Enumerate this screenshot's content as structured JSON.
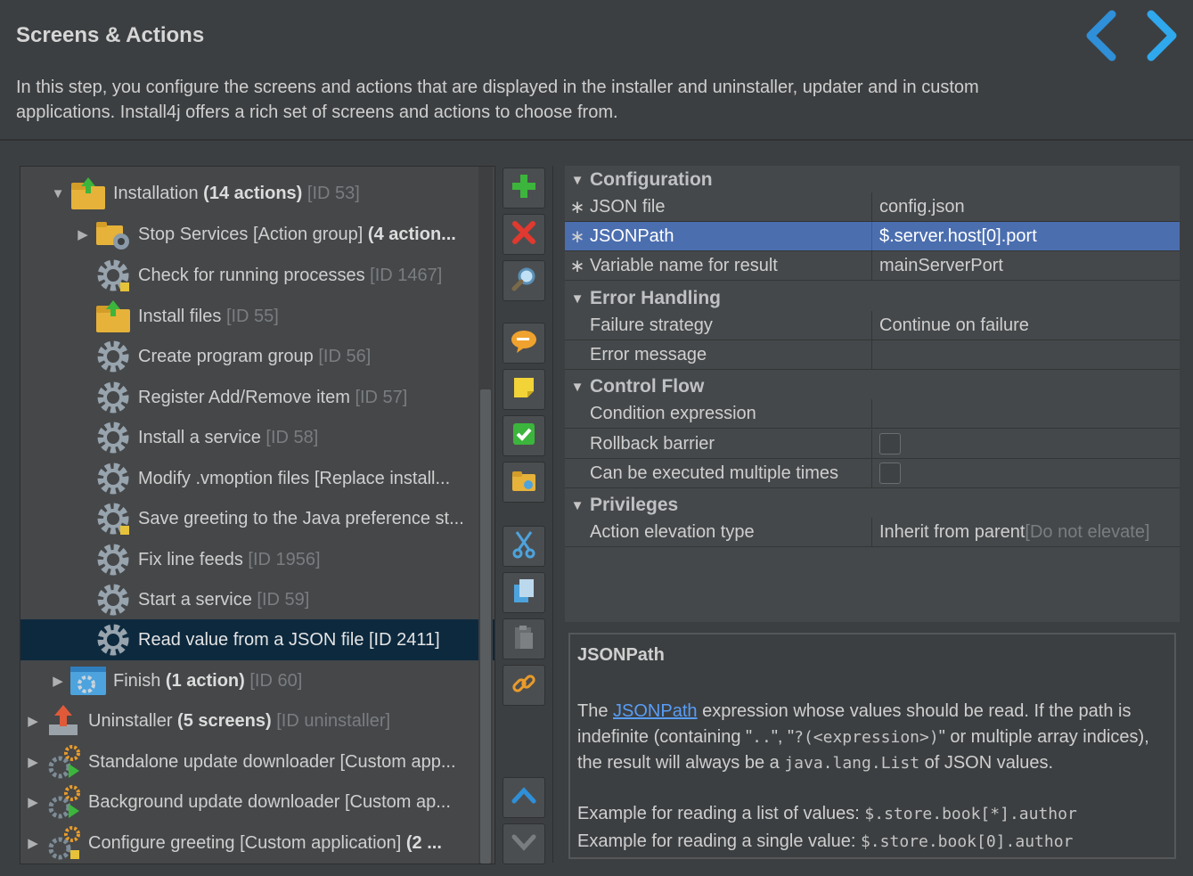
{
  "header": {
    "title": "Screens & Actions",
    "description": "In this step, you configure the screens and actions that are displayed in the installer and uninstaller, updater and in custom applications. Install4j offers a rich set of screens and actions to choose from."
  },
  "tree": {
    "items": [
      {
        "name": "Installation ",
        "bold": "(14 actions)",
        "id": " [ID 53]"
      },
      {
        "name": "Stop Services [Action group] ",
        "bold": "(4 action...",
        "id": ""
      },
      {
        "name": "Check for running processes ",
        "bold": "",
        "id": "[ID 1467]"
      },
      {
        "name": "Install files ",
        "bold": "",
        "id": "[ID 55]"
      },
      {
        "name": "Create program group ",
        "bold": "",
        "id": "[ID 56]"
      },
      {
        "name": "Register Add/Remove item ",
        "bold": "",
        "id": "[ID 57]"
      },
      {
        "name": "Install a service ",
        "bold": "",
        "id": "[ID 58]"
      },
      {
        "name": "Modify .vmoption files [Replace install...",
        "bold": "",
        "id": ""
      },
      {
        "name": "Save greeting to the Java preference st...",
        "bold": "",
        "id": ""
      },
      {
        "name": "Fix line feeds ",
        "bold": "",
        "id": "[ID 1956]"
      },
      {
        "name": "Start a service ",
        "bold": "",
        "id": "[ID 59]"
      },
      {
        "name": "Read value from a JSON file [ID 2411]",
        "bold": "",
        "id": ""
      },
      {
        "name": "Finish ",
        "bold": "(1 action)",
        "id": " [ID 60]"
      },
      {
        "name": "Uninstaller ",
        "bold": "(5 screens)",
        "id": " [ID uninstaller]"
      },
      {
        "name": "Standalone update downloader [Custom app...",
        "bold": "",
        "id": ""
      },
      {
        "name": "Background update downloader [Custom ap...",
        "bold": "",
        "id": ""
      },
      {
        "name": "Configure greeting [Custom application] ",
        "bold": "(2 ...",
        "id": ""
      }
    ]
  },
  "toolbar": {
    "icons": [
      "add-icon",
      "delete-icon",
      "search-icon",
      "comment-icon",
      "note-icon",
      "check-icon",
      "folder-icon",
      "cut-icon",
      "copy-icon",
      "paste-icon",
      "link-icon",
      "move-up-icon",
      "move-down-icon"
    ]
  },
  "props": {
    "sections": {
      "configuration": "Configuration",
      "error_handling": "Error Handling",
      "control_flow": "Control Flow",
      "privileges": "Privileges"
    },
    "rows": {
      "json_file": {
        "name": "JSON file",
        "value": "config.json"
      },
      "json_path": {
        "name": "JSONPath",
        "value": "$.server.host[0].port"
      },
      "variable_name": {
        "name": "Variable name for result",
        "value": "mainServerPort"
      },
      "failure_strategy": {
        "name": "Failure strategy",
        "value": "Continue on failure"
      },
      "error_message": {
        "name": "Error message",
        "value": ""
      },
      "condition_expression": {
        "name": "Condition expression",
        "value": ""
      },
      "rollback_barrier": {
        "name": "Rollback barrier"
      },
      "multiple_times": {
        "name": "Can be executed multiple times"
      },
      "elevation": {
        "name": "Action elevation type",
        "value": "Inherit from parent ",
        "muted": "[Do not elevate]"
      }
    },
    "required_mark": "∗"
  },
  "help": {
    "title": "JSONPath",
    "p1_a": "The ",
    "p1_link": "JSONPath",
    "p1_b": " expression whose values should be read. If the path is indefinite (containing \"",
    "p1_code1": "..",
    "p1_c": "\", \"",
    "p1_code2": "?(<expression>)",
    "p1_d": "\" or multiple array indices), the result will always be a ",
    "p1_code3": "java.lang.List",
    "p1_e": " of JSON values.",
    "ex1_label": "Example for reading a list of values: ",
    "ex1_code": "$.store.book[*].author",
    "ex2_label": "Example for reading a single value: ",
    "ex2_code": "$.store.book[0].author"
  },
  "colors": {
    "background": "#3c3f41",
    "selection": "#4b6eaf",
    "tree_selection": "#0d293e",
    "accent": "#2d9fe3"
  }
}
